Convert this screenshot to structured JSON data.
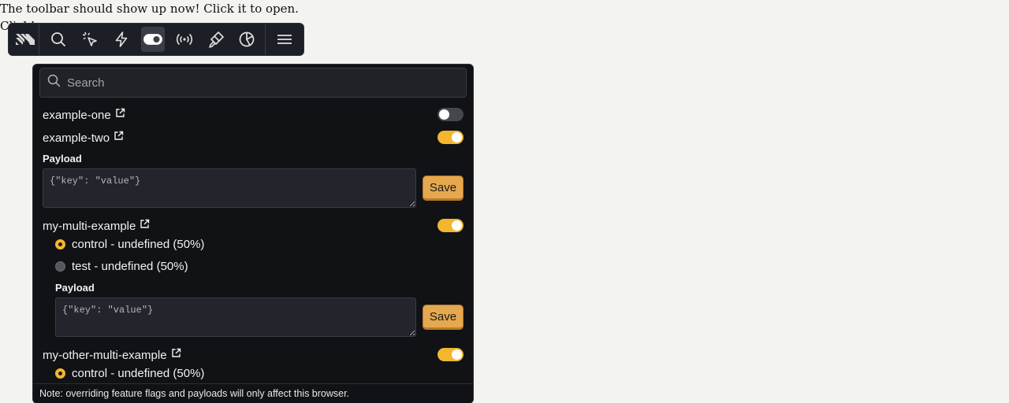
{
  "page": {
    "line1": "The toolbar should show up now! Click it to open.",
    "line2": "Click!"
  },
  "toolbar": {
    "items": [
      {
        "icon": "logo-icon"
      },
      {
        "icon": "search-icon"
      },
      {
        "icon": "inspect-icon"
      },
      {
        "icon": "actions-icon"
      },
      {
        "icon": "toggle-icon",
        "active": true
      },
      {
        "icon": "broadcast-icon"
      },
      {
        "icon": "heatmap-icon"
      },
      {
        "icon": "pie-chart-icon"
      },
      {
        "icon": "menu-icon"
      }
    ]
  },
  "panel": {
    "search_placeholder": "Search",
    "flags": [
      {
        "name": "example-one",
        "enabled": false
      },
      {
        "name": "example-two",
        "enabled": true,
        "payload_label": "Payload",
        "payload_placeholder": "{\"key\": \"value\"}",
        "save_label": "Save"
      },
      {
        "name": "my-multi-example",
        "enabled": true,
        "variants": [
          {
            "label": "control - undefined (50%)",
            "selected": true
          },
          {
            "label": "test - undefined (50%)",
            "selected": false
          }
        ],
        "payload_label": "Payload",
        "payload_placeholder": "{\"key\": \"value\"}",
        "save_label": "Save"
      },
      {
        "name": "my-other-multi-example",
        "enabled": true,
        "variants": [
          {
            "label": "control - undefined (50%)",
            "selected": true
          }
        ]
      }
    ],
    "footer_note": "Note: overriding feature flags and payloads will only affect this browser."
  },
  "colors": {
    "accent": "#f2b72f",
    "save_button": "#e6a84f",
    "panel_bg": "#111216",
    "toolbar_bg": "#1d1f27"
  }
}
